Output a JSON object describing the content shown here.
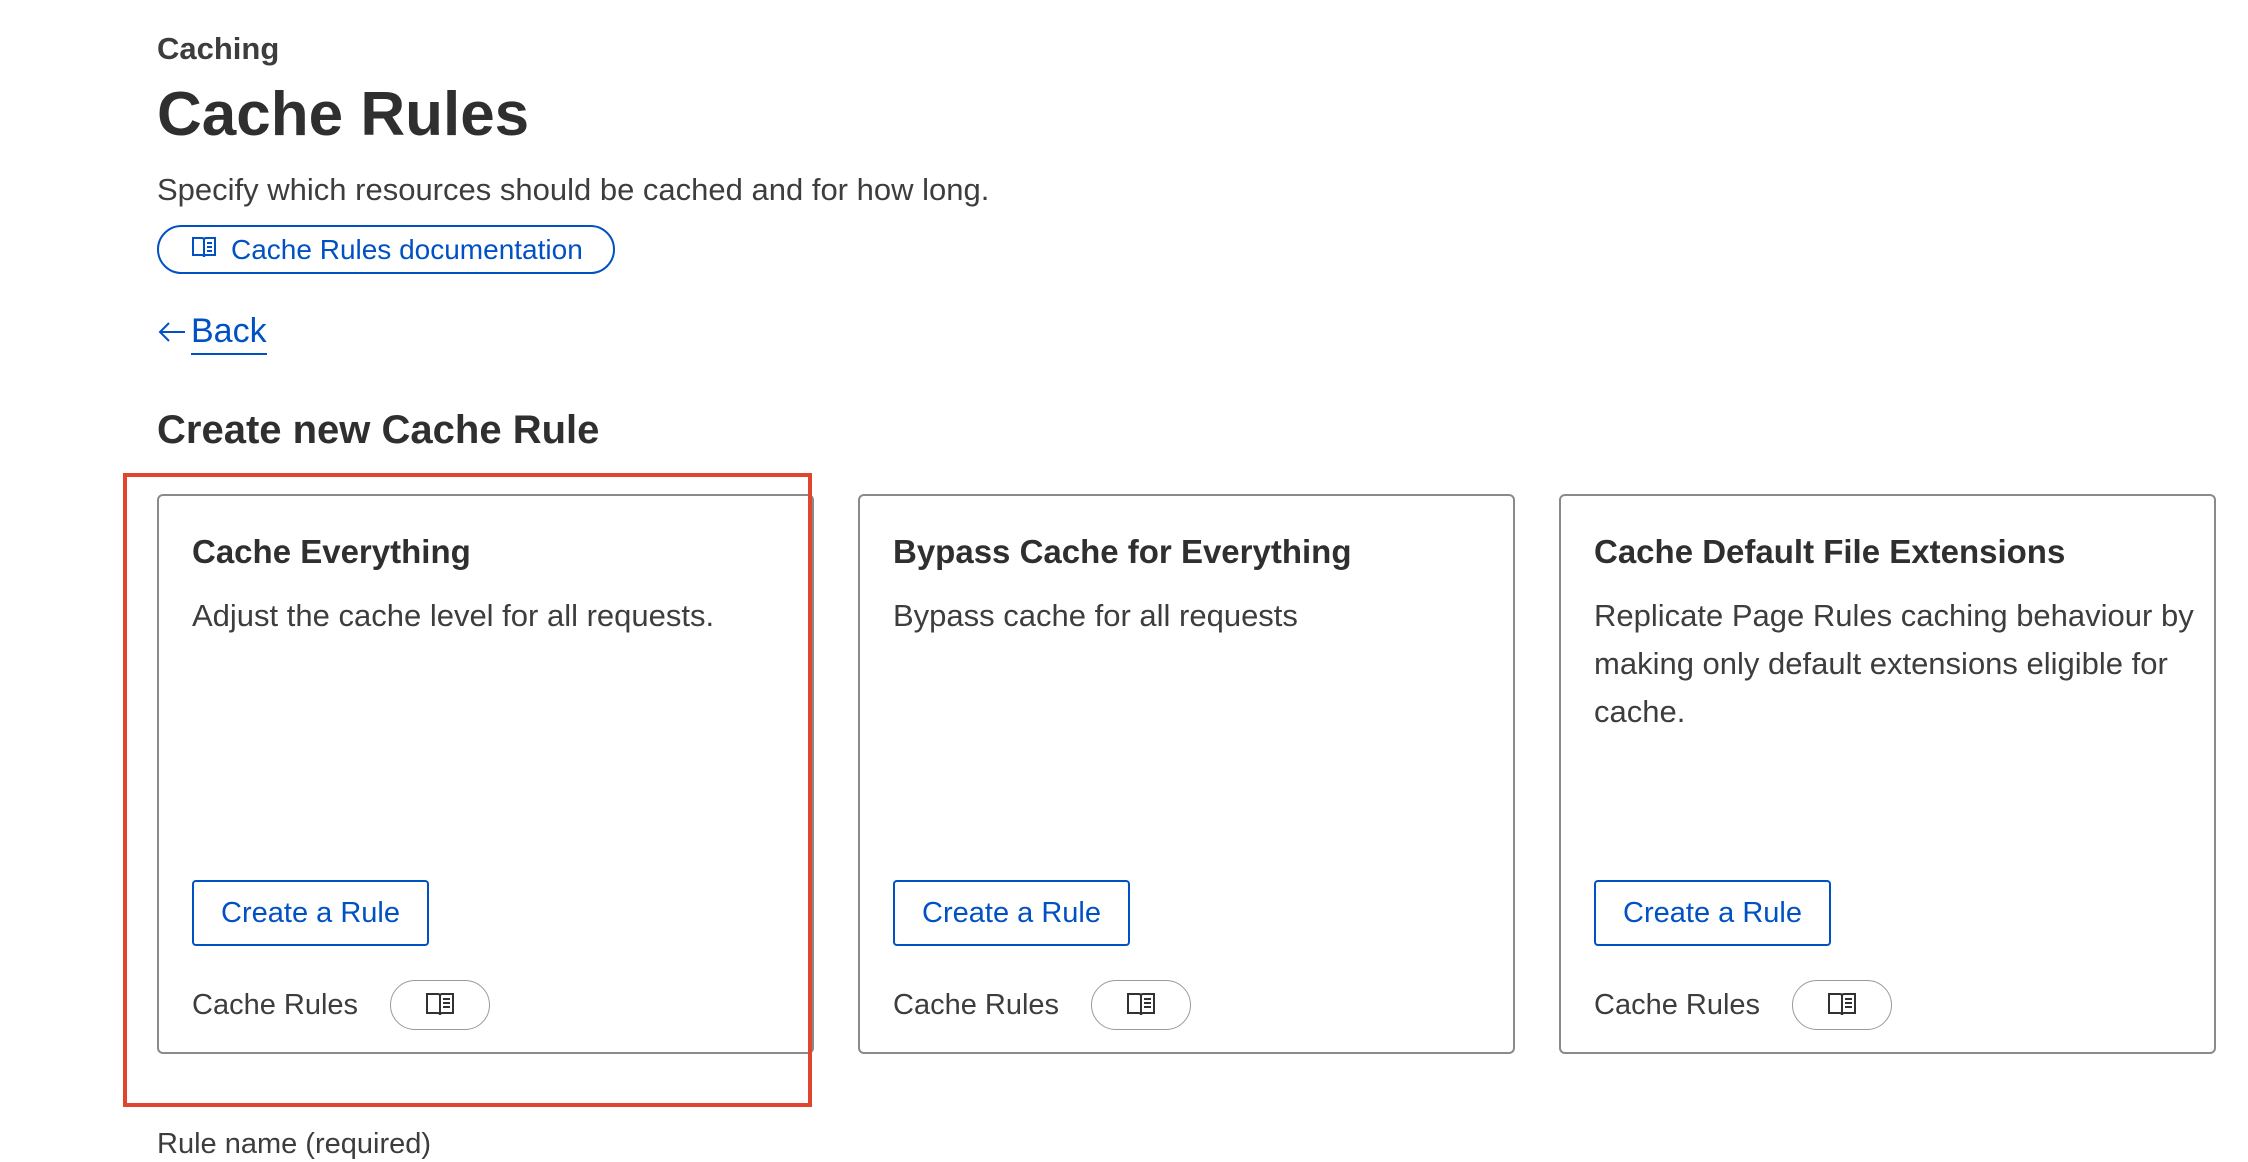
{
  "header": {
    "breadcrumb": "Caching",
    "title": "Cache Rules",
    "subtitle": "Specify which resources should be cached and for how long.",
    "doc_link_label": "Cache Rules documentation"
  },
  "nav": {
    "back_label": "Back"
  },
  "section": {
    "title": "Create new Cache Rule"
  },
  "cards": [
    {
      "title": "Cache Everything",
      "description": "Adjust the cache level for all requests.",
      "button_label": "Create a Rule",
      "footer_label": "Cache Rules"
    },
    {
      "title": "Bypass Cache for Everything",
      "description": "Bypass cache for all requests",
      "button_label": "Create a Rule",
      "footer_label": "Cache Rules"
    },
    {
      "title": "Cache Default File Extensions",
      "description": "Replicate Page Rules caching behaviour by making only default extensions eligible for cache.",
      "button_label": "Create a Rule",
      "footer_label": "Cache Rules"
    }
  ],
  "form": {
    "rule_name_label": "Rule name (required)"
  },
  "colors": {
    "link_blue": "#0051c3",
    "highlight_red": "#e0452e",
    "card_border": "#8a8a8a"
  },
  "icons": {
    "documentation": "book-icon",
    "back": "arrow-left-icon"
  }
}
